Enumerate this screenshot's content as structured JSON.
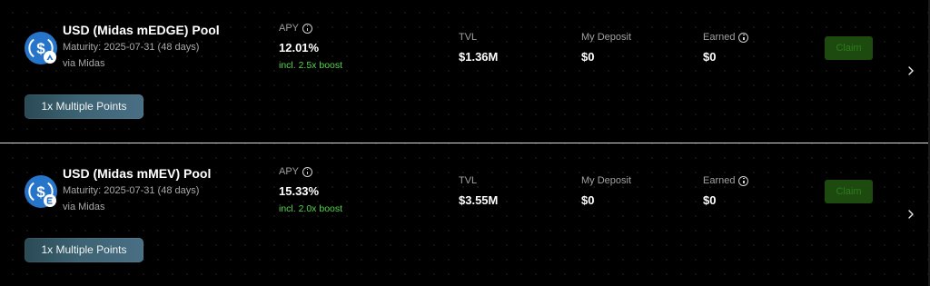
{
  "pools": [
    {
      "name": "USD (Midas mEDGE) Pool",
      "maturity": "Maturity: 2025-07-31 (48 days)",
      "via": "via Midas",
      "points_badge": "1x Multiple Points",
      "icon": "usdc-dollar-icon",
      "sub_icon": "midas-mark-icon",
      "apy_label": "APY",
      "apy_value": "12.01%",
      "apy_boost": "incl. 2.5x boost",
      "tvl_label": "TVL",
      "tvl_value": "$1.36M",
      "deposit_label": "My Deposit",
      "deposit_value": "$0",
      "earned_label": "Earned",
      "earned_value": "$0",
      "claim_label": "Claim"
    },
    {
      "name": "USD (Midas mMEV) Pool",
      "maturity": "Maturity: 2025-07-31 (48 days)",
      "via": "via Midas",
      "points_badge": "1x Multiple Points",
      "icon": "usdc-dollar-icon",
      "sub_icon": "midas-e-mark-icon",
      "apy_label": "APY",
      "apy_value": "15.33%",
      "apy_boost": "incl. 2.0x boost",
      "tvl_label": "TVL",
      "tvl_value": "$3.55M",
      "deposit_label": "My Deposit",
      "deposit_value": "$0",
      "earned_label": "Earned",
      "earned_value": "$0",
      "claim_label": "Claim"
    }
  ],
  "colors": {
    "background": "#000000",
    "accent_green": "#52d64a",
    "claim_bg": "#1c4a0f",
    "claim_text": "#2f7a1e",
    "icon_blue": "#2775ca",
    "badge_gradient": [
      "#2a4a55",
      "#4a6f85"
    ]
  }
}
